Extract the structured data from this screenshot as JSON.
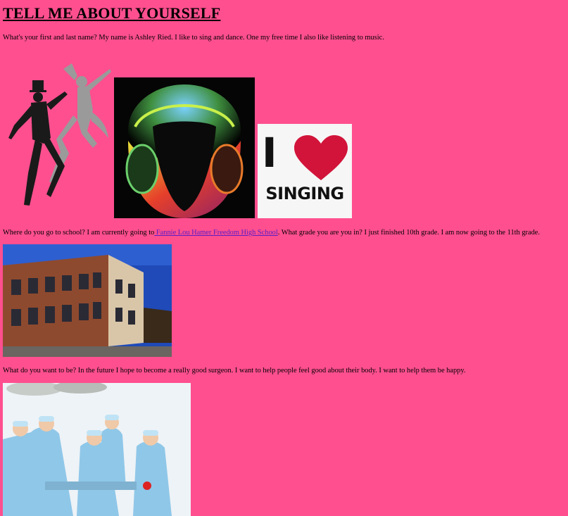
{
  "heading": "TELL ME ABOUT YOURSELF",
  "intro": {
    "question": "What's your first and last name?",
    "answer": "My name is Ashley Ried. I like to sing and dance. One my free time I also like listening to music."
  },
  "school": {
    "question": "Where do you go to school?",
    "before_link": "I am currently going to",
    "link_text": " Fannie Lou Hamer Freedom High School",
    "after_link": ". What grade you are you in? I just finished 10th grade. I am now going to the 11th grade."
  },
  "future": {
    "text": "What do you want to be? In the future I hope to become a really good surgeon. I want to help people feel good about their body. I want to help them be happy."
  },
  "singing_badge": {
    "line1": "I",
    "line2": "SINGING"
  },
  "colors": {
    "background": "#ff4f8f",
    "link": "#5a1cc4",
    "heart": "#d2143a"
  }
}
